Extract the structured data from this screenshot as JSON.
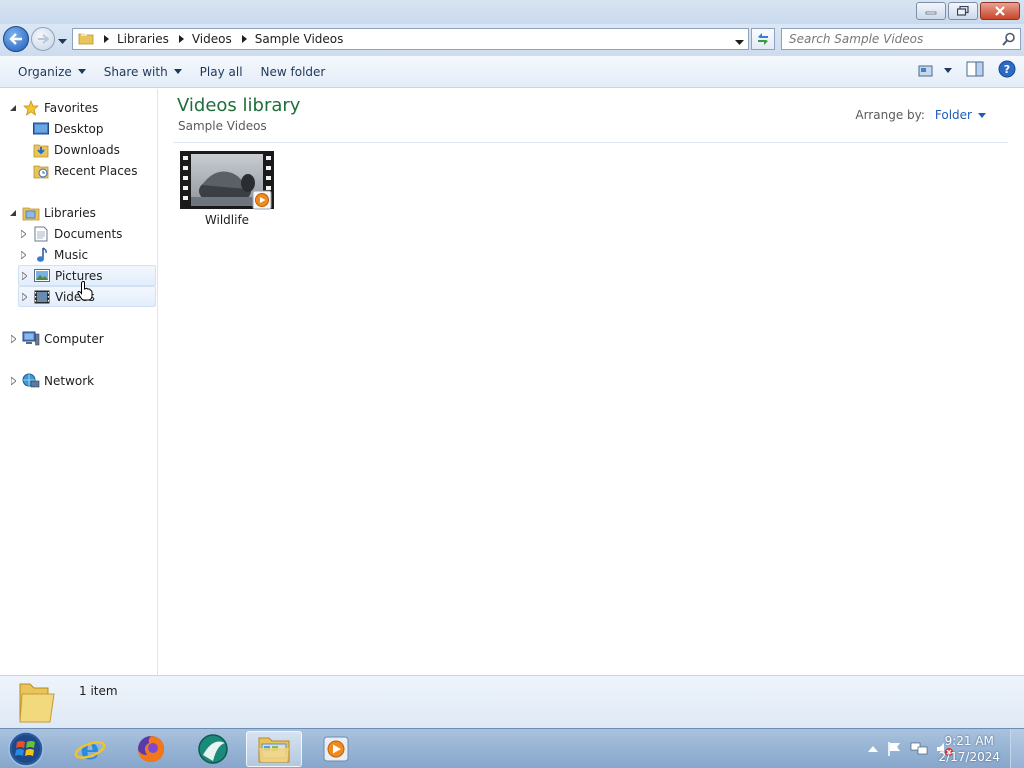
{
  "address": {
    "breadcrumbs": [
      "Libraries",
      "Videos",
      "Sample Videos"
    ],
    "search_placeholder": "Search Sample Videos"
  },
  "toolbar": {
    "organize": "Organize",
    "share_with": "Share with",
    "play_all": "Play all",
    "new_folder": "New folder"
  },
  "nav": {
    "favorites": "Favorites",
    "desktop": "Desktop",
    "downloads": "Downloads",
    "recent_places": "Recent Places",
    "libraries": "Libraries",
    "documents": "Documents",
    "music": "Music",
    "pictures": "Pictures",
    "videos": "Videos",
    "computer": "Computer",
    "network": "Network"
  },
  "content": {
    "title": "Videos library",
    "subtitle": "Sample Videos",
    "arrange_label": "Arrange by:",
    "arrange_value": "Folder",
    "items": [
      {
        "name": "Wildlife"
      }
    ]
  },
  "details": {
    "count": "1 item"
  },
  "taskbar": {
    "time": "9:21 AM",
    "date": "2/17/2024"
  },
  "colors": {
    "library_title": "#1e6e3a",
    "link_blue": "#1e5cb8"
  }
}
